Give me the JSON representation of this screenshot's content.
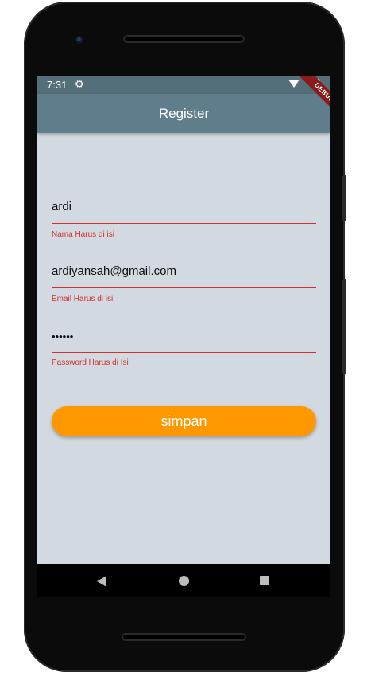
{
  "status_bar": {
    "time": "7:31",
    "settings_icon": "gear-icon",
    "wifi_icon": "wifi-icon",
    "battery_icon": "battery-icon"
  },
  "app_bar": {
    "title": "Register",
    "debug_banner": "DEBUG",
    "color": "#607d8b"
  },
  "form": {
    "name": {
      "value": "ardi",
      "error": "Nama Harus di isi"
    },
    "email": {
      "value": "ardiyansah@gmail.com",
      "error": "Email Harus di isi"
    },
    "password": {
      "value": "••••••",
      "error": "Password Harus di Isi"
    },
    "error_color": "#d32f2f",
    "submit_label": "simpan",
    "submit_color": "#ff9800"
  },
  "nav_bar": {
    "back_icon": "back-triangle-icon",
    "home_icon": "home-circle-icon",
    "recents_icon": "recents-square-icon"
  }
}
